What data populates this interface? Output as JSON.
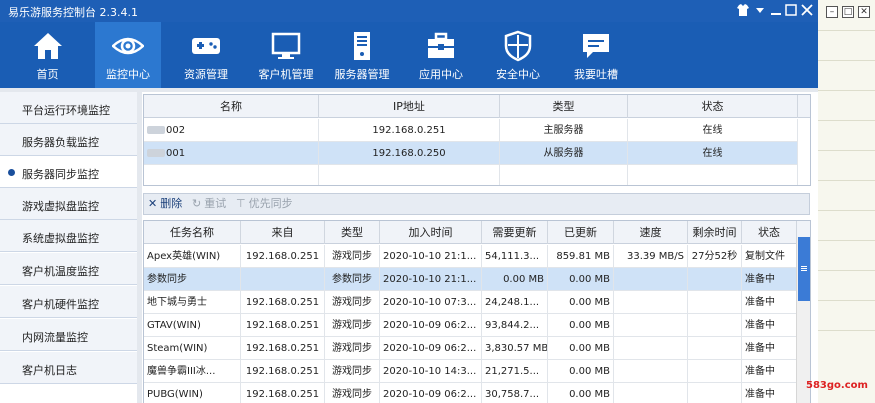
{
  "window": {
    "title": "易乐游服务控制台 2.3.4.1"
  },
  "topnav": [
    {
      "label": "首页",
      "icon": "home-icon"
    },
    {
      "label": "监控中心",
      "icon": "eye-icon",
      "active": true
    },
    {
      "label": "资源管理",
      "icon": "gamepad-icon"
    },
    {
      "label": "客户机管理",
      "icon": "monitor-icon"
    },
    {
      "label": "服务器管理",
      "icon": "server-icon"
    },
    {
      "label": "应用中心",
      "icon": "toolbox-icon"
    },
    {
      "label": "安全中心",
      "icon": "shield-icon"
    },
    {
      "label": "我要吐槽",
      "icon": "chat-icon"
    }
  ],
  "sidebar": [
    {
      "label": "平台运行环境监控"
    },
    {
      "label": "服务器负载监控"
    },
    {
      "label": "服务器同步监控",
      "active": true
    },
    {
      "label": "游戏虚拟盘监控"
    },
    {
      "label": "系统虚拟盘监控"
    },
    {
      "label": "客户机温度监控"
    },
    {
      "label": "客户机硬件监控"
    },
    {
      "label": "内网流量监控"
    },
    {
      "label": "客户机日志"
    }
  ],
  "servers": {
    "headers": [
      "名称",
      "IP地址",
      "类型",
      "状态"
    ],
    "rows": [
      {
        "name": "002",
        "ip": "192.168.0.251",
        "type": "主服务器",
        "status": "在线"
      },
      {
        "name": "001",
        "ip": "192.168.0.250",
        "type": "从服务器",
        "status": "在线"
      }
    ]
  },
  "toolbar": {
    "delete": "删除",
    "retry": "重试",
    "priority": "优先同步"
  },
  "tasks": {
    "headers": [
      "任务名称",
      "来自",
      "类型",
      "加入时间",
      "需要更新",
      "已更新",
      "速度",
      "剩余时间",
      "状态"
    ],
    "rows": [
      {
        "name": "Apex英雄(WIN)",
        "from": "192.168.0.251",
        "type": "游戏同步",
        "time": "2020-10-10 21:1...",
        "need": "54,111.3...",
        "done": "859.81 MB",
        "speed": "33.39 MB/S",
        "remain": "27分52秒",
        "status": "复制文件"
      },
      {
        "name": "参数同步",
        "from": "",
        "type": "参数同步",
        "time": "2020-10-10 21:1...",
        "need": "0.00 MB",
        "done": "0.00 MB",
        "speed": "",
        "remain": "",
        "status": "准备中"
      },
      {
        "name": "地下城与勇士",
        "from": "192.168.0.251",
        "type": "游戏同步",
        "time": "2020-10-10 07:3...",
        "need": "24,248.1...",
        "done": "0.00 MB",
        "speed": "",
        "remain": "",
        "status": "准备中"
      },
      {
        "name": "GTAV(WIN)",
        "from": "192.168.0.251",
        "type": "游戏同步",
        "time": "2020-10-09 06:2...",
        "need": "93,844.2...",
        "done": "0.00 MB",
        "speed": "",
        "remain": "",
        "status": "准备中"
      },
      {
        "name": "Steam(WIN)",
        "from": "192.168.0.251",
        "type": "游戏同步",
        "time": "2020-10-09 06:2...",
        "need": "3,830.57 MB",
        "done": "0.00 MB",
        "speed": "",
        "remain": "",
        "status": "准备中"
      },
      {
        "name": "魔兽争霸III冰...",
        "from": "192.168.0.251",
        "type": "游戏同步",
        "time": "2020-10-10 14:3...",
        "need": "21,271.5...",
        "done": "0.00 MB",
        "speed": "",
        "remain": "",
        "status": "准备中"
      },
      {
        "name": "PUBG(WIN)",
        "from": "192.168.0.251",
        "type": "游戏同步",
        "time": "2020-10-09 06:2...",
        "need": "30,758.7...",
        "done": "0.00 MB",
        "speed": "",
        "remain": "",
        "status": "准备中"
      }
    ]
  },
  "watermark": "583go.com",
  "colors": {
    "nav": "#1a5db4",
    "nav_active": "#2c78d0",
    "row_selected": "#cfe2f7"
  }
}
